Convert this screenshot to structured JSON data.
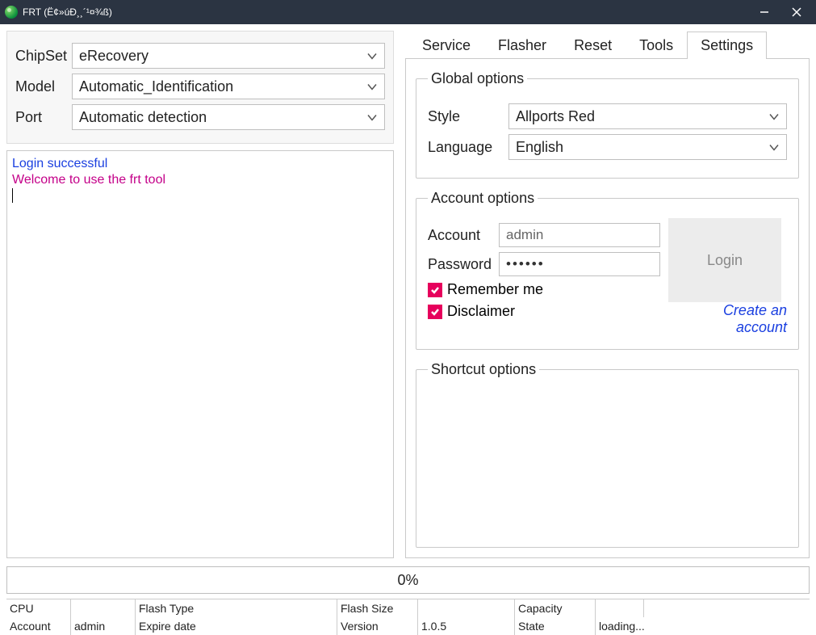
{
  "window": {
    "title": "FRT (Ë¢»úÐ¸¸´¹¤¾ß)"
  },
  "device": {
    "chipset_label": "ChipSet",
    "chipset_value": "eRecovery",
    "model_label": "Model",
    "model_value": "Automatic_Identification",
    "port_label": "Port",
    "port_value": "Automatic detection"
  },
  "log": {
    "line1": "Login successful",
    "line2": "Welcome to use the frt tool"
  },
  "tabs": {
    "service": "Service",
    "flasher": "Flasher",
    "reset": "Reset",
    "tools": "Tools",
    "settings": "Settings"
  },
  "global_options": {
    "legend": "Global options",
    "style_label": "Style",
    "style_value": "Allports Red",
    "language_label": "Language",
    "language_value": "English"
  },
  "account_options": {
    "legend": "Account options",
    "account_label": "Account",
    "account_value": "admin",
    "password_label": "Password",
    "password_mask": "••••••",
    "login_button": "Login",
    "remember_label": "Remember me",
    "disclaimer_label": "Disclaimer",
    "create_link": "Create an account"
  },
  "shortcut_options": {
    "legend": "Shortcut options"
  },
  "progress": {
    "text": "0%"
  },
  "status": {
    "row1": {
      "cpu_label": "CPU",
      "cpu_value": "",
      "flashtype_label": "Flash Type",
      "flashtype_value": "",
      "flashsize_label": "Flash Size",
      "flashsize_value": "",
      "capacity_label": "Capacity",
      "capacity_value": ""
    },
    "row2": {
      "account_label": "Account",
      "account_value": "admin",
      "expire_label": "Expire date",
      "expire_value": "",
      "version_label": "Version",
      "version_value": "1.0.5",
      "state_label": "State",
      "state_value": "loading..."
    }
  }
}
